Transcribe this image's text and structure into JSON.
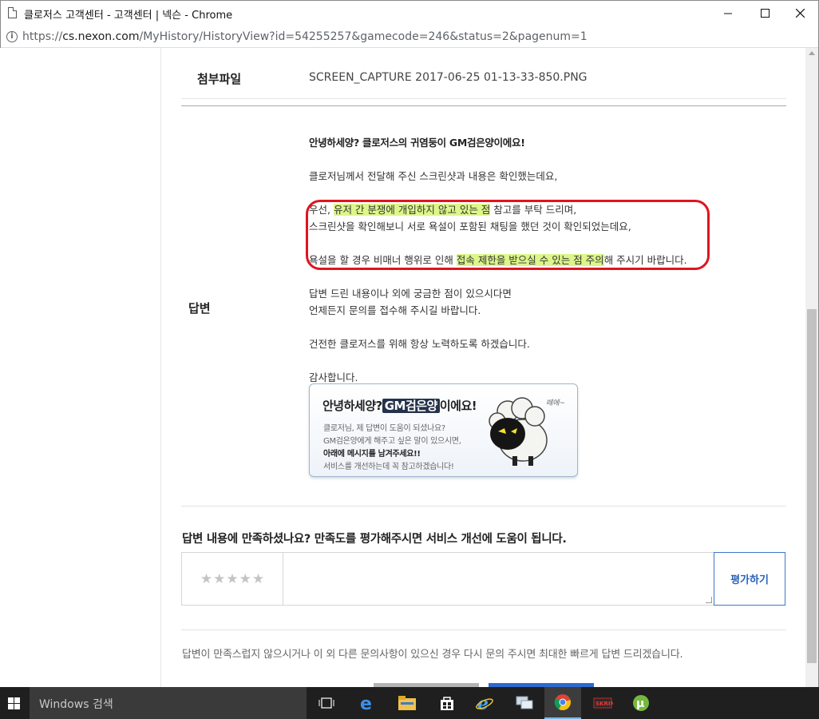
{
  "window": {
    "title": "클로저스 고객센터 - 고객센터 | 넥슨 - Chrome",
    "url_prefix": "https://",
    "url_host": "cs.nexon.com",
    "url_path": "/MyHistory/HistoryView?id=54255257&gamecode=246&status=2&pagenum=1"
  },
  "attachment": {
    "label": "첨부파일",
    "filename": "SCREEN_CAPTURE 2017-06-25 01-13-33-850.PNG"
  },
  "answer": {
    "label": "답변",
    "greeting": "안녕하세양? 클로저스의 귀염둥이 GM검은양이에요!",
    "line1": "클로저님께서 전달해 주신 스크린샷과 내용은 확인했는데요,",
    "line2_pre": "우선, ",
    "line2_hl": "유저 간 분쟁에 개입하지 않고 있는 점",
    "line2_post": " 참고를 부탁 드리며,",
    "line3": "스크린샷을 확인해보니 서로 욕설이 포함된 채팅을 했던 것이 확인되었는데요,",
    "line4_pre": "욕설을 할 경우 비매너 행위로 인해 ",
    "line4_hl": "접속 제한을 받으실 수 있는 점 주의",
    "line4_post": "해 주시기 바랍니다.",
    "line5": "답변 드린 내용이나 외에 궁금한 점이 있으시다면",
    "line6": "언제든지 문의를 접수해 주시길 바랍니다.",
    "line7": "건전한 클로저스를 위해 항상 노력하도록 하겠습니다.",
    "line8": "감사합니다."
  },
  "banner": {
    "title_pre": "안녕하세양?",
    "title_badge": "GM검은양",
    "title_post": "이에요!",
    "line1": "클로저님, 제 답변이 도움이 되셨나요?",
    "line2": "GM검은양에게 해주고 싶은 말이 있으시면,",
    "line3": "아래에 메시지를 남겨주세요!!",
    "line4": "서비스를 개선하는데 꼭 참고하겠습니다!",
    "sfx": "떼에~"
  },
  "rating": {
    "question": "답변 내용에 만족하셨나요? 만족도를 평가해주시면 서비스 개선에 도움이 됩니다.",
    "stars": [
      "★",
      "★",
      "★",
      "★",
      "★"
    ],
    "button": "평가하기"
  },
  "footnote": "답변이 만족스럽지 않으시거나 이 외 다른 문의사항이 있으신 경우 다시 문의 주시면 최대한 빠르게 답변 드리겠습니다.",
  "taskbar": {
    "search_placeholder": "Windows 검색"
  }
}
